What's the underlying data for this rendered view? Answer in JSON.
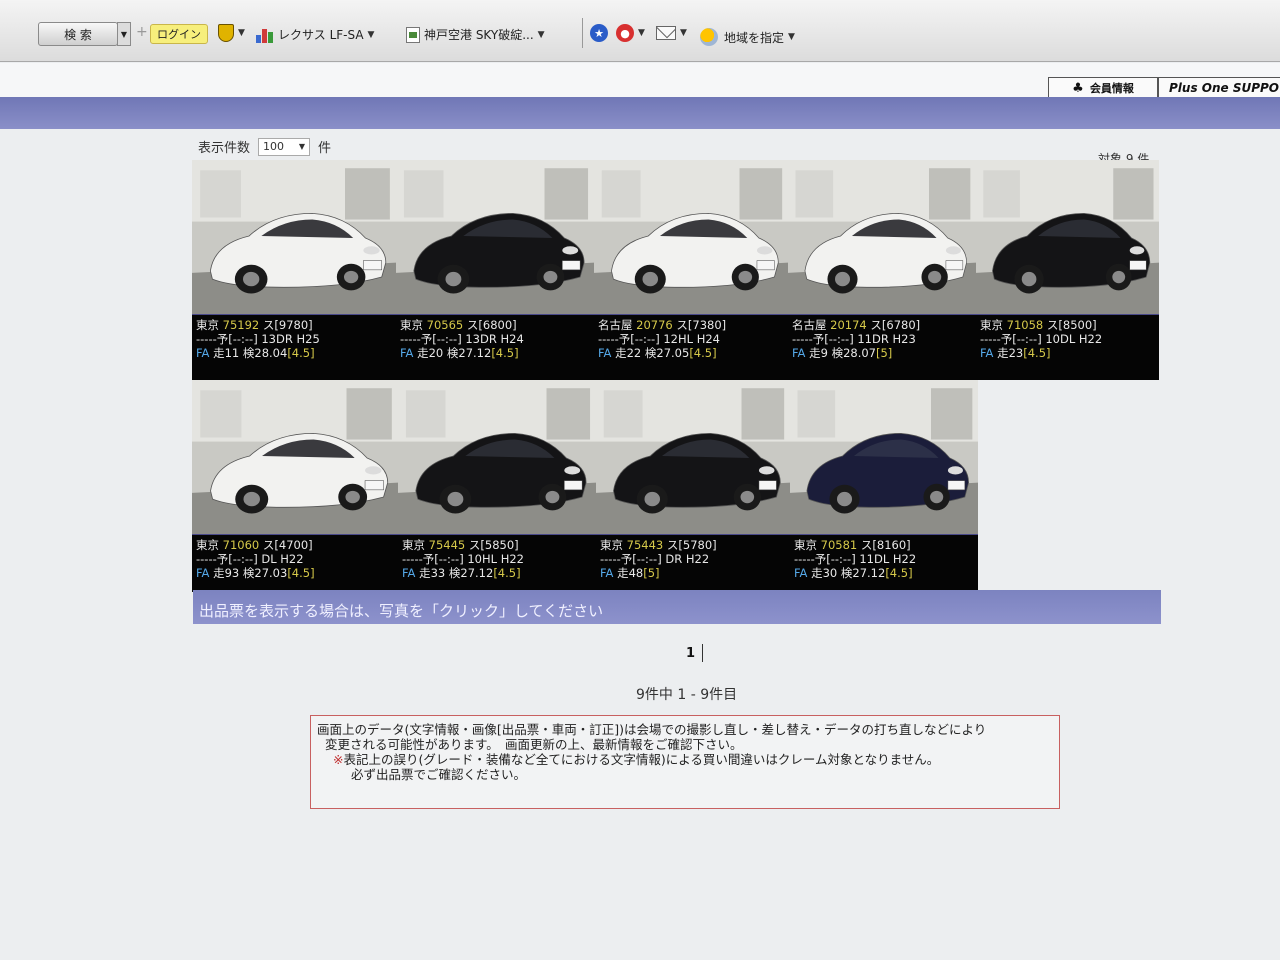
{
  "toolbar": {
    "search_label": "検 索",
    "login_label": "ログイン",
    "lexus_label": "レクサス LF-SA",
    "kobe_label": "神戸空港 SKY破綻...",
    "region_label": "地域を指定"
  },
  "header": {
    "member_label": "会員情報",
    "plus_one_label": "Plus One SUPPO"
  },
  "listing": {
    "per_page_label": "表示件数",
    "per_page_value": "100",
    "per_page_unit": "件",
    "total_label": "対象 9 件"
  },
  "cars": [
    {
      "location": "東京",
      "lot": "75192",
      "code": "ス[9780]",
      "line2": "-----予[--:--] 13DR H25",
      "fa": "FA",
      "line3": "走11 検28.04",
      "grade": "[4.5]",
      "color": "white"
    },
    {
      "location": "東京",
      "lot": "70565",
      "code": "ス[6800]",
      "line2": "-----予[--:--] 13DR H24",
      "fa": "FA",
      "line3": "走20 検27.12",
      "grade": "[4.5]",
      "color": "black"
    },
    {
      "location": "名古屋",
      "lot": "20776",
      "code": "ス[7380]",
      "line2": "-----予[--:--] 12HL H24",
      "fa": "FA",
      "line3": "走22 検27.05",
      "grade": "[4.5]",
      "color": "white"
    },
    {
      "location": "名古屋",
      "lot": "20174",
      "code": "ス[6780]",
      "line2": "-----予[--:--] 11DR H23",
      "fa": "FA",
      "line3": "走9 検28.07",
      "grade": "[5]",
      "color": "white"
    },
    {
      "location": "東京",
      "lot": "71058",
      "code": "ス[8500]",
      "line2": "-----予[--:--] 10DL H22",
      "fa": "FA",
      "line3": "走23",
      "grade": "[4.5]",
      "color": "black"
    },
    {
      "location": "東京",
      "lot": "71060",
      "code": "ス[4700]",
      "line2": "-----予[--:--] DL H22",
      "fa": "FA",
      "line3": "走93 検27.03",
      "grade": "[4.5]",
      "color": "white"
    },
    {
      "location": "東京",
      "lot": "75445",
      "code": "ス[5850]",
      "line2": "-----予[--:--] 10HL H22",
      "fa": "FA",
      "line3": "走33 検27.12",
      "grade": "[4.5]",
      "color": "black"
    },
    {
      "location": "東京",
      "lot": "75443",
      "code": "ス[5780]",
      "line2": "-----予[--:--] DR H22",
      "fa": "FA",
      "line3": "走48",
      "grade": "[5]",
      "color": "black"
    },
    {
      "location": "東京",
      "lot": "70581",
      "code": "ス[8160]",
      "line2": "-----予[--:--] 11DL H22",
      "fa": "FA",
      "line3": "走30 検27.12",
      "grade": "[4.5]",
      "color": "navy"
    }
  ],
  "footer": {
    "notice": "出品票を表示する場合は、写真を「クリック」してください",
    "page_current": "1",
    "range": "9件中 1 - 9件目",
    "disclaimer_line1": "画面上のデータ(文字情報・画像[出品票・車両・訂正])は会場での撮影し直し・差し替え・データの打ち直しなどにより",
    "disclaimer_line2": "変更される可能性があります。　画面更新の上、最新情報をご確認下さい。",
    "disclaimer_mark": "※",
    "disclaimer_line3": "表記上の誤り(グレード・装備など全てにおける文字情報)による買い間違いはクレーム対象となりません。",
    "disclaimer_line4": "必ず出品票でご確認ください。"
  },
  "colors": {
    "band": "#7a80bf",
    "card_bg": "#050505",
    "lot_number": "#d6c94a",
    "fa_tag": "#55a8e8"
  }
}
